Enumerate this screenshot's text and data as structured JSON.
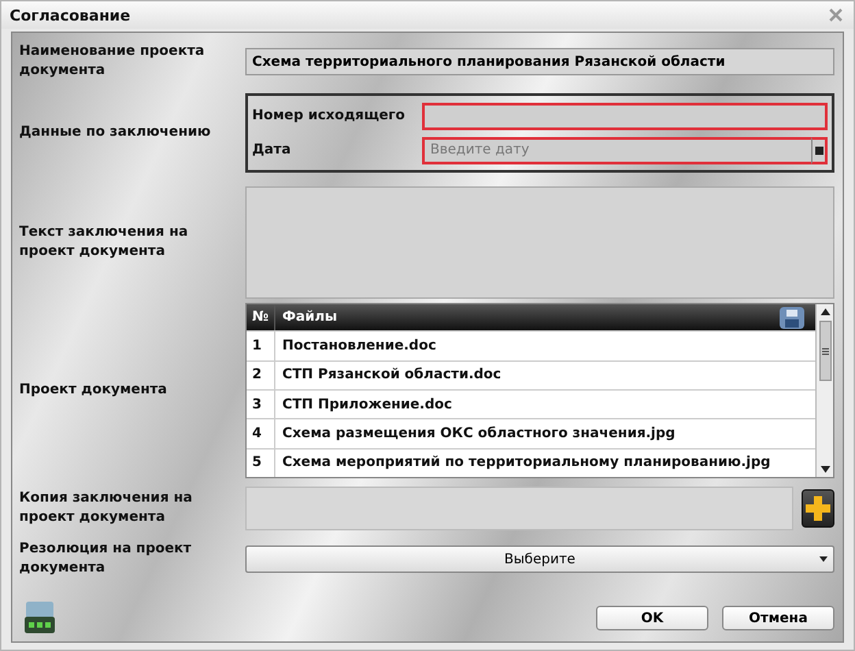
{
  "window": {
    "title": "Согласование"
  },
  "project_name": {
    "label": "Наименование проекта документа",
    "value": "Схема территориального планирования Рязанской области"
  },
  "conclusion_data": {
    "label": "Данные по заключению",
    "fields": [
      {
        "label": "Номер исходящего",
        "invalid": true
      },
      {
        "label": "Дата",
        "placeholder": "Введите дату",
        "invalid": true
      }
    ]
  },
  "conclusion_text": {
    "label": "Текст заключения на проект документа"
  },
  "project_document": {
    "label": "Проект документа",
    "table": {
      "columns": [
        "№",
        "Файлы"
      ],
      "rows": [
        {
          "num": "1",
          "file": "Постановление.doc"
        },
        {
          "num": "2",
          "file": "СТП Рязанской области.doc"
        },
        {
          "num": "3",
          "file": "СТП Приложение.doc"
        },
        {
          "num": "4",
          "file": "Схема размещения ОКС областного значения.jpg"
        },
        {
          "num": "5",
          "file": "Схема мероприятий по территориальному планированию.jpg"
        }
      ]
    }
  },
  "conclusion_copy": {
    "label": "Копия заключения на проект документа"
  },
  "resolution": {
    "label": "Резолюция на проект документа",
    "value": "Выберите"
  },
  "buttons": [
    "OK",
    "Отмена"
  ]
}
